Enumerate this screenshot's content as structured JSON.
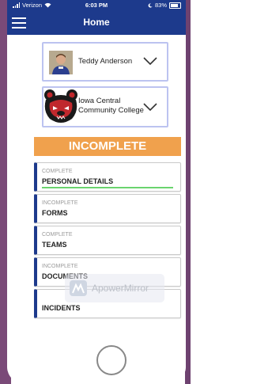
{
  "status_bar": {
    "carrier": "Verizon",
    "time": "6:03 PM",
    "battery": "83%"
  },
  "navbar": {
    "title": "Home"
  },
  "athlete": {
    "name": "Teddy  Anderson"
  },
  "college": {
    "line1": "Iowa Central",
    "line2": "Community College"
  },
  "overall_status": "INCOMPLETE",
  "tasks": [
    {
      "status": "COMPLETE",
      "title": "PERSONAL DETAILS",
      "progress": 1.0
    },
    {
      "status": "INCOMPLETE",
      "title": "FORMS"
    },
    {
      "status": "COMPLETE",
      "title": "TEAMS"
    },
    {
      "status": "INCOMPLETE",
      "title": "DOCUMENTS"
    },
    {
      "status": "",
      "title": "INCIDENTS"
    }
  ],
  "watermark": {
    "text": "ApowerMirror"
  },
  "colors": {
    "nav_blue": "#1d3a8c",
    "status_orange": "#f0a14d",
    "progress_green": "#6ad46e"
  }
}
